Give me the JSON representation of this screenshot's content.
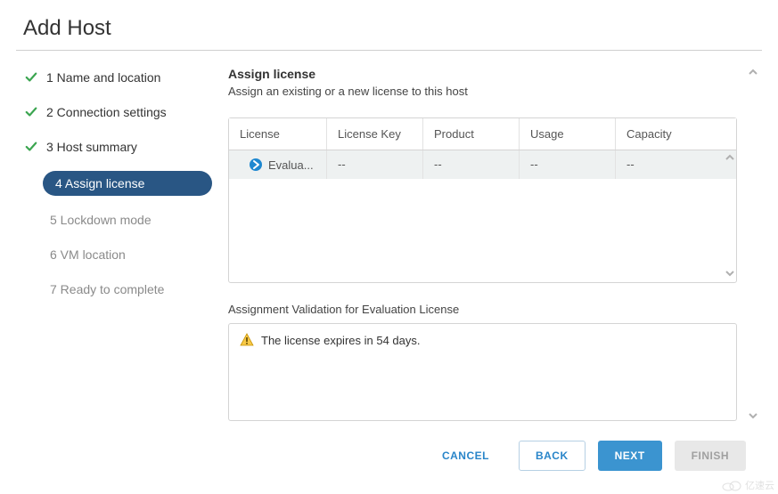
{
  "dialog": {
    "title": "Add Host"
  },
  "steps": [
    {
      "label": "1 Name and location",
      "state": "done"
    },
    {
      "label": "2 Connection settings",
      "state": "done"
    },
    {
      "label": "3 Host summary",
      "state": "done"
    },
    {
      "label": "4 Assign license",
      "state": "active"
    },
    {
      "label": "5 Lockdown mode",
      "state": "future"
    },
    {
      "label": "6 VM location",
      "state": "future"
    },
    {
      "label": "7 Ready to complete",
      "state": "future"
    }
  ],
  "section": {
    "title": "Assign license",
    "desc": "Assign an existing or a new license to this host"
  },
  "table": {
    "headers": {
      "license": "License",
      "key": "License Key",
      "product": "Product",
      "usage": "Usage",
      "capacity": "Capacity"
    },
    "rows": [
      {
        "license": "Evalua...",
        "key": "--",
        "product": "--",
        "usage": "--",
        "capacity": "--"
      }
    ]
  },
  "validation": {
    "label": "Assignment Validation for Evaluation License",
    "message": "The license expires in 54 days."
  },
  "footer": {
    "cancel": "CANCEL",
    "back": "BACK",
    "next": "NEXT",
    "finish": "FINISH"
  },
  "watermark": "亿速云"
}
